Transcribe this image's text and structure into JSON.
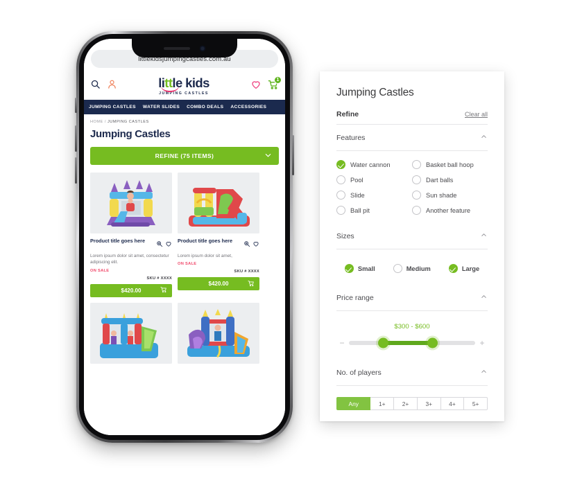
{
  "phone": {
    "browser": {
      "url": "littlekidsjumpingcastles.com.au",
      "reload_icon": "reload-icon"
    },
    "header": {
      "search_icon": "search-icon",
      "account_icon": "account-icon",
      "wishlist_icon": "heart-icon",
      "cart_icon": "cart-icon",
      "cart_count": "1",
      "logo": {
        "part1": "li",
        "part2": "tt",
        "part3": "le kids",
        "tagline": "JUMPING CASTLES"
      }
    },
    "nav": [
      {
        "label": "JUMPING CASTLES"
      },
      {
        "label": "WATER SLIDES"
      },
      {
        "label": "COMBO DEALS"
      },
      {
        "label": "ACCESSORIES"
      }
    ],
    "breadcrumb": {
      "home": "HOME",
      "sep": " / ",
      "current": "JUMPING CASTLES"
    },
    "page_title": "Jumping Castles",
    "refine_button": {
      "label": "REFINE (75 ITEMS)",
      "chevron": "chevron-down-icon"
    },
    "products": [
      {
        "title": "Product title goes here",
        "desc": "Lorem ipsum dolor sit amet, consectetur adipiscing elit.",
        "sale": "ON SALE",
        "sku": "SKU # XXXX",
        "price": "$420.00"
      },
      {
        "title": "Product title goes here",
        "desc": "Lorem ipsum dolor sit amet,",
        "sale": "ON SALE",
        "sku": "SKU # XXXX",
        "price": "$420.00"
      }
    ]
  },
  "panel": {
    "title": "Jumping Castles",
    "refine_label": "Refine",
    "clear_all": "Clear all",
    "features": {
      "title": "Features",
      "collapse_icon": "chevron-up-icon",
      "options": [
        {
          "label": "Water cannon",
          "checked": true
        },
        {
          "label": "Basket ball hoop",
          "checked": false
        },
        {
          "label": "Pool",
          "checked": false
        },
        {
          "label": "Dart balls",
          "checked": false
        },
        {
          "label": "Slide",
          "checked": false
        },
        {
          "label": "Sun shade",
          "checked": false
        },
        {
          "label": "Ball pit",
          "checked": false
        },
        {
          "label": "Another feature",
          "checked": false
        }
      ]
    },
    "sizes": {
      "title": "Sizes",
      "collapse_icon": "chevron-up-icon",
      "options": [
        {
          "label": "Small",
          "checked": true
        },
        {
          "label": "Medium",
          "checked": false
        },
        {
          "label": "Large",
          "checked": true
        }
      ]
    },
    "price_range": {
      "title": "Price range",
      "collapse_icon": "chevron-up-icon",
      "value": "$300 - $600",
      "min_icon": "minus-icon",
      "max_icon": "plus-icon",
      "low_pct": 27,
      "high_pct": 66
    },
    "players": {
      "title": "No. of players",
      "collapse_icon": "chevron-up-icon",
      "options": [
        {
          "label": "Any",
          "selected": true
        },
        {
          "label": "1+",
          "selected": false
        },
        {
          "label": "2+",
          "selected": false
        },
        {
          "label": "3+",
          "selected": false
        },
        {
          "label": "4+",
          "selected": false
        },
        {
          "label": "5+",
          "selected": false
        }
      ]
    }
  },
  "colors": {
    "green": "#76bc21",
    "navy": "#1b2a4e",
    "pink": "#e8336d",
    "sale_red": "#f0486a",
    "orange": "#f0845e"
  }
}
